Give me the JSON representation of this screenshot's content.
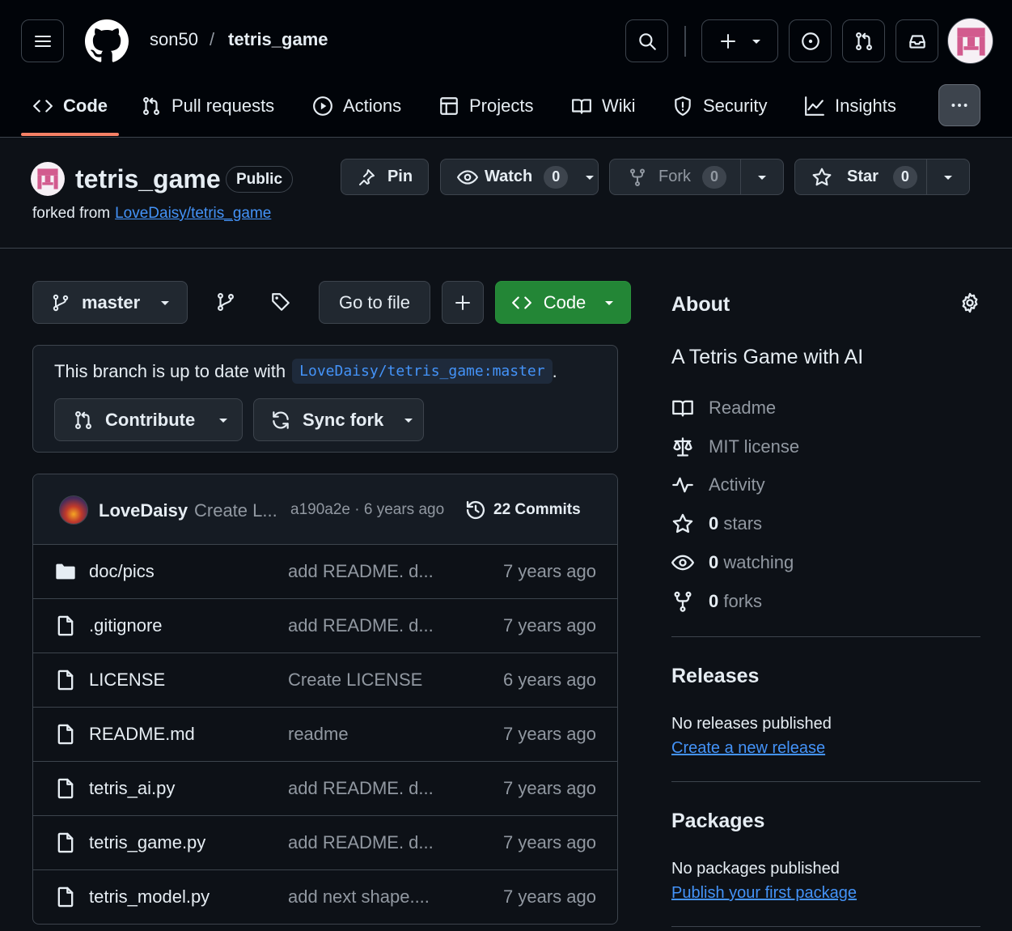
{
  "header": {
    "owner": "son50",
    "separator": "/",
    "repo": "tetris_game"
  },
  "nav": [
    {
      "label": "Code",
      "icon": "code-icon"
    },
    {
      "label": "Pull requests",
      "icon": "git-pull-request-icon"
    },
    {
      "label": "Actions",
      "icon": "play-icon"
    },
    {
      "label": "Projects",
      "icon": "table-icon"
    },
    {
      "label": "Wiki",
      "icon": "book-icon"
    },
    {
      "label": "Security",
      "icon": "shield-icon"
    },
    {
      "label": "Insights",
      "icon": "graph-icon"
    }
  ],
  "repo": {
    "name": "tetris_game",
    "visibility": "Public",
    "forked_prefix": "forked from",
    "forked_from": "LoveDaisy/tetris_game",
    "pin_label": "Pin",
    "watch_label": "Watch",
    "watch_count": "0",
    "fork_label": "Fork",
    "fork_count": "0",
    "star_label": "Star",
    "star_count": "0"
  },
  "toolbar": {
    "branch": "master",
    "go_to_file": "Go to file",
    "code_label": "Code"
  },
  "sync": {
    "text": "This branch is up to date with",
    "ref": "LoveDaisy/tetris_game:master",
    "period": ".",
    "contribute_label": "Contribute",
    "sync_label": "Sync fork"
  },
  "commit": {
    "author": "LoveDaisy",
    "message": "Create L...",
    "hash_age": "a190a2e · 6 years ago",
    "commits_label": "22 Commits"
  },
  "files": [
    {
      "name": "doc/pics",
      "type": "folder",
      "message": "add README. d...",
      "age": "7 years ago"
    },
    {
      "name": ".gitignore",
      "type": "file",
      "message": "add README. d...",
      "age": "7 years ago"
    },
    {
      "name": "LICENSE",
      "type": "file",
      "message": "Create LICENSE",
      "age": "6 years ago"
    },
    {
      "name": "README.md",
      "type": "file",
      "message": "readme",
      "age": "7 years ago"
    },
    {
      "name": "tetris_ai.py",
      "type": "file",
      "message": "add README. d...",
      "age": "7 years ago"
    },
    {
      "name": "tetris_game.py",
      "type": "file",
      "message": "add README. d...",
      "age": "7 years ago"
    },
    {
      "name": "tetris_model.py",
      "type": "file",
      "message": "add next shape....",
      "age": "7 years ago"
    }
  ],
  "about": {
    "title": "About",
    "description": "A Tetris Game with AI",
    "readme": "Readme",
    "license": "MIT license",
    "activity": "Activity",
    "stars_count": "0",
    "stars_label": "stars",
    "watching_count": "0",
    "watching_label": "watching",
    "forks_count": "0",
    "forks_label": "forks"
  },
  "releases": {
    "title": "Releases",
    "empty": "No releases published",
    "create_link": "Create a new release"
  },
  "packages": {
    "title": "Packages",
    "empty": "No packages published",
    "publish_link": "Publish your first package"
  },
  "colors": {
    "bg": "#0d1117",
    "header_bg": "#010409",
    "border": "#3d444d",
    "accent_green": "#238636",
    "link": "#4493f8",
    "nav_underline": "#f78166"
  }
}
